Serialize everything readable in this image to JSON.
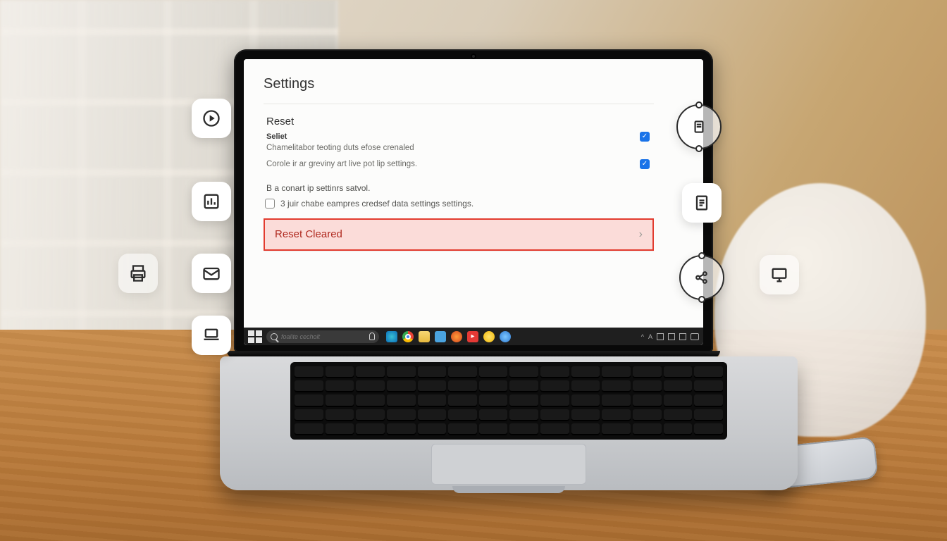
{
  "app": {
    "title": "Settings",
    "section_title": "Reset",
    "row1": {
      "subhead": "Seliet",
      "text": "Chamelitabor teoting duts efose crenaled"
    },
    "row2": {
      "text": "Corole ir ar greviny art live pot lip settings."
    },
    "note": "B a conart ip settinrs satvol.",
    "opt_text": "3 juir chabe eampres credsef data settings settings.",
    "reset_button": "Reset Cleared"
  },
  "taskbar": {
    "search_placeholder": "foalite cecholt",
    "tray_up": "^",
    "tray_a": "A"
  },
  "tiles": {
    "play": "play-icon",
    "chart": "chart-icon",
    "mail": "mail-icon",
    "print": "print-icon",
    "laptop": "laptop-icon",
    "sync_doc": "sync-document-icon",
    "doc": "document-icon",
    "share": "share-nodes-icon",
    "monitor": "monitor-icon"
  },
  "colors": {
    "accent": "#1a73e8",
    "danger_border": "#e23b2e",
    "danger_fill": "#fbdcd9",
    "danger_text": "#b02a20"
  }
}
